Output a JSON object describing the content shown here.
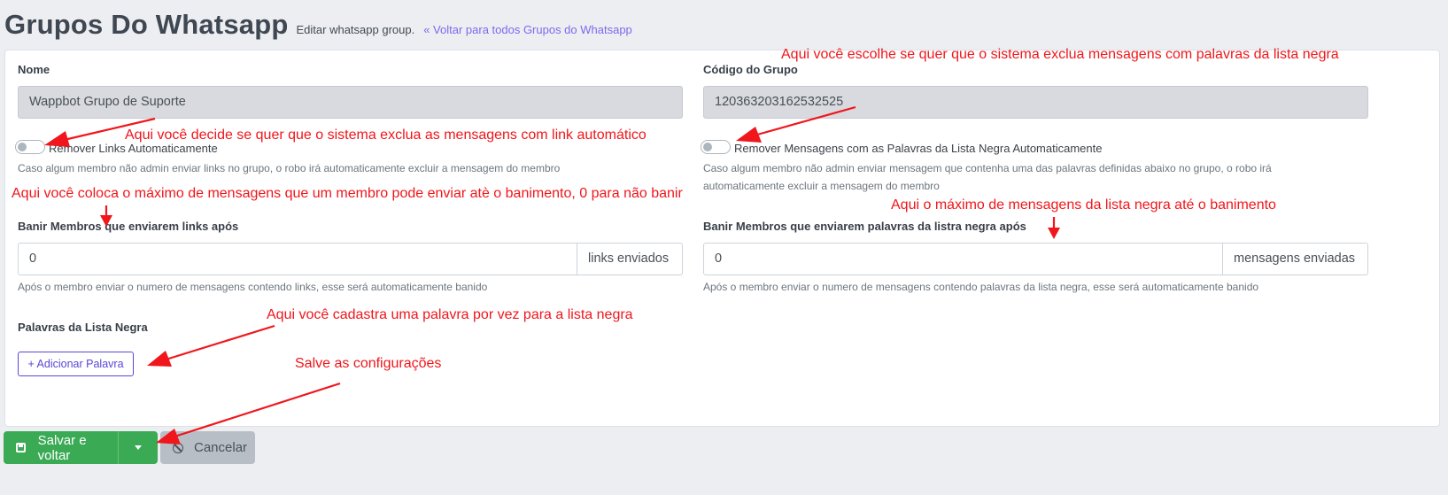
{
  "header": {
    "title": "Grupos Do Whatsapp",
    "subtitle": "Editar whatsapp group.",
    "back_link": "« Voltar para todos Grupos do Whatsapp"
  },
  "form": {
    "nome": {
      "label": "Nome",
      "value": "Wappbot Grupo de Suporte"
    },
    "codigo": {
      "label": "Código do Grupo",
      "value": "120363203162532525"
    },
    "remove_links": {
      "label": "Remover Links Automaticamente",
      "help": "Caso algum membro não admin enviar links no grupo, o robo irá automaticamente excluir a mensagem do membro",
      "enabled": false
    },
    "remove_blacklist": {
      "label": "Remover Mensagens com as Palavras da Lista Negra Automaticamente",
      "help_line1": "Caso algum membro não admin enviar mensagem que contenha uma das palavras definidas abaixo no grupo, o robo irá",
      "help_line2": "automaticamente excluir a mensagem do membro",
      "enabled": false
    },
    "ban_links": {
      "label": "Banir Membros que enviarem links após",
      "value": "0",
      "addon": "links enviados",
      "help": "Após o membro enviar o numero de mensagens contendo links, esse será automaticamente banido"
    },
    "ban_blacklist": {
      "label": "Banir Membros que enviarem palavras da listra negra após",
      "value": "0",
      "addon": "mensagens enviadas",
      "help": "Após o membro enviar o numero de mensagens contendo palavras da lista negra, esse será automaticamente banido"
    },
    "blacklist": {
      "label": "Palavras da Lista Negra",
      "add_button": "+ Adicionar Palavra"
    }
  },
  "actions": {
    "save": "Salvar e voltar",
    "cancel": "Cancelar"
  },
  "annotations": {
    "color": "#f0161b",
    "blacklist_toggle": "Aqui você escolhe se quer que o sistema exclua mensagens com palavras da lista negra",
    "links_toggle": "Aqui você decide se quer que o sistema exclua as mensagens com link automático",
    "max_messages": "Aqui você coloca o máximo de mensagens que um membro pode enviar atè o banimento, 0 para não banir",
    "max_blacklist": "Aqui o máximo de mensagens da lista negra até o banimento",
    "add_word": "Aqui você cadastra uma palavra por vez para a lista negra",
    "save_config": "Salve as configurações"
  },
  "colors": {
    "primary": "#5a46d6",
    "link": "#7c69ef",
    "success": "#3aaa55",
    "secondary": "#b8bec6"
  }
}
